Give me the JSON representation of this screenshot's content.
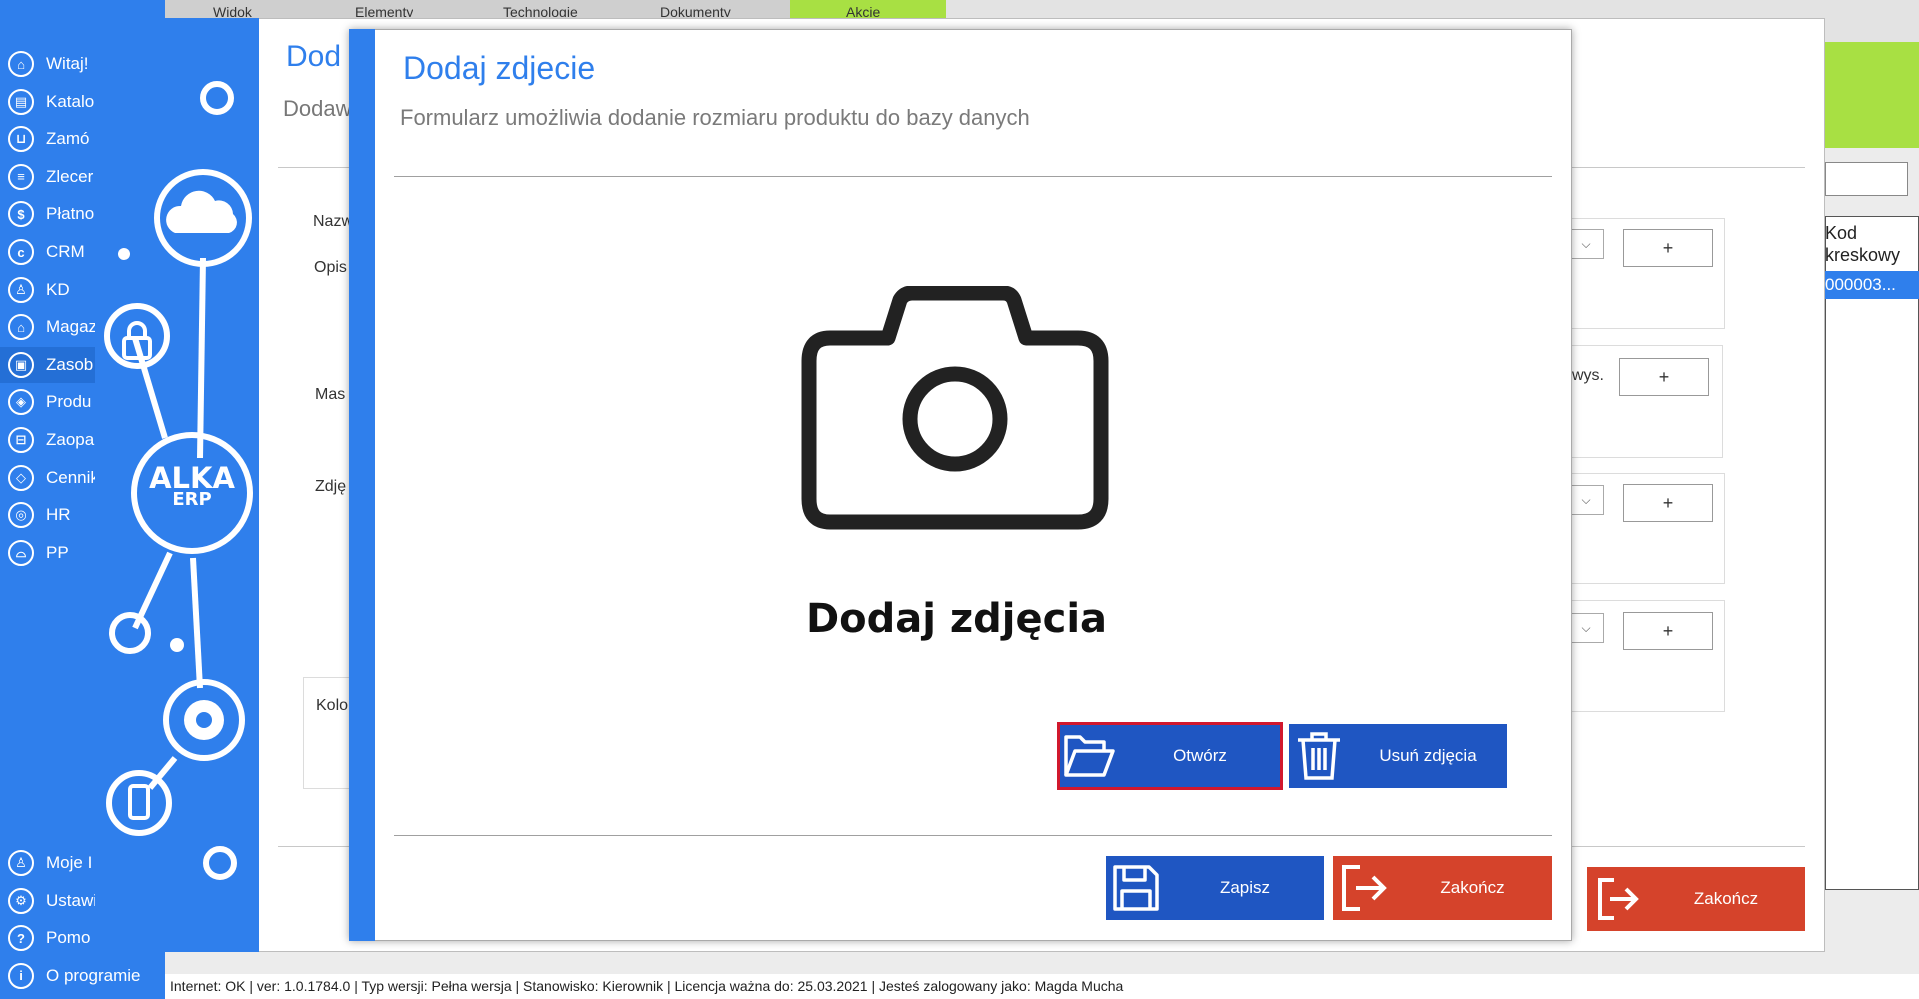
{
  "top_tabs": [
    "Widok",
    "Elementy",
    "Technologie",
    "Dokumenty",
    "Akcje"
  ],
  "nav": {
    "items": [
      {
        "label": "Witaj!",
        "icon": "home-icon"
      },
      {
        "label": "Katalo",
        "icon": "book-icon"
      },
      {
        "label": "Zamó",
        "icon": "cart-icon"
      },
      {
        "label": "Zlecer",
        "icon": "list-icon"
      },
      {
        "label": "Płatno",
        "icon": "dollar-icon"
      },
      {
        "label": "CRM",
        "icon": "crm-icon"
      },
      {
        "label": "KD",
        "icon": "person-icon"
      },
      {
        "label": "Magaz",
        "icon": "warehouse-icon"
      },
      {
        "label": "Zasob",
        "icon": "box-icon"
      },
      {
        "label": "Produ",
        "icon": "production-icon"
      },
      {
        "label": "Zaopa",
        "icon": "truck-icon"
      },
      {
        "label": "Cennik",
        "icon": "tag-icon"
      },
      {
        "label": "HR",
        "icon": "hr-icon"
      },
      {
        "label": "PP",
        "icon": "pp-icon"
      }
    ],
    "bottom_items": [
      {
        "label": "Moje I",
        "icon": "user-icon"
      },
      {
        "label": "Ustawi",
        "icon": "settings-icon"
      },
      {
        "label": "Pomo",
        "icon": "help-icon"
      },
      {
        "label": "O programie",
        "icon": "info-icon"
      }
    ]
  },
  "brand": {
    "logo_line1": "ALKA",
    "logo_line2": "ERP"
  },
  "background_form": {
    "title": "Dod",
    "subtitle": "Dodaw",
    "labels": [
      "Nazw",
      "Opis",
      "Mas",
      "Zdję",
      "Kolo"
    ],
    "side_label": "wys.",
    "plus_label": "+",
    "select_chevron": "⌵",
    "close_label": "Zakończ"
  },
  "right_table": {
    "header": "Kod kreskowy",
    "cell": "000003..."
  },
  "modal": {
    "title": "Dodaj zdjecie",
    "subtitle": "Formularz umożliwia dodanie rozmiaru produktu do bazy danych",
    "photo_caption": "Dodaj zdjęcia",
    "open_label": "Otwórz",
    "remove_label": "Usuń zdjęcia",
    "save_label": "Zapisz",
    "close_label": "Zakończ"
  },
  "status_bar": "Internet: OK  |   ver: 1.0.1784.0   |   Typ wersji: Pełna wersja   |   Stanowisko: Kierownik   |   Licencja ważna do: 25.03.2021   |   Jesteś zalogowany jako: Magda Mucha",
  "colors": {
    "accent": "#2f7fec",
    "button_blue": "#1f56c2",
    "button_red": "#d5432b",
    "highlight": "#a8e043",
    "focus_outline": "#d1182d"
  }
}
